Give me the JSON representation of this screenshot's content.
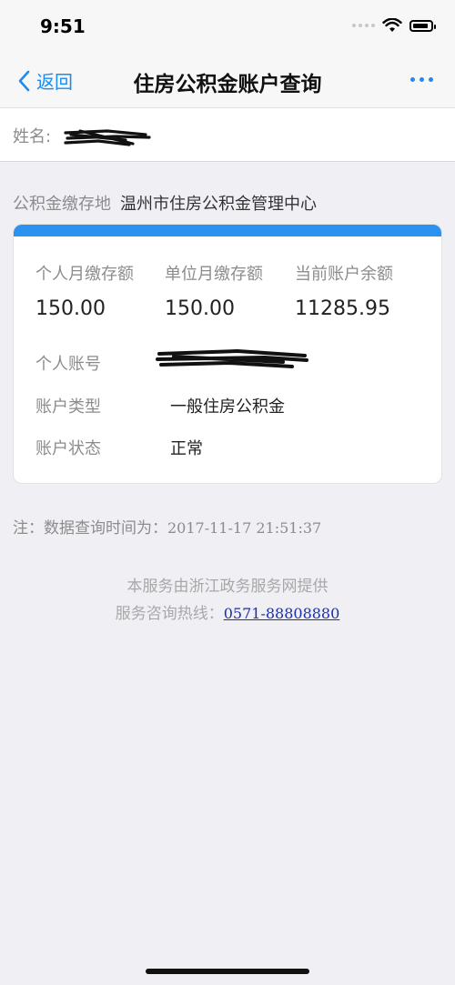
{
  "status_bar": {
    "time": "9:51"
  },
  "nav": {
    "back_label": "返回",
    "title": "住房公积金账户查询"
  },
  "name_row": {
    "label": "姓名:"
  },
  "fund_location": {
    "label": "公积金缴存地",
    "value": "温州市住房公积金管理中心"
  },
  "card": {
    "stats": [
      {
        "label": "个人月缴存额",
        "value": "150.00"
      },
      {
        "label": "单位月缴存额",
        "value": "150.00"
      },
      {
        "label": "当前账户余额",
        "value": "11285.95"
      }
    ],
    "info": [
      {
        "label": "个人账号",
        "value": ""
      },
      {
        "label": "账户类型",
        "value": "一般住房公积金"
      },
      {
        "label": "账户状态",
        "value": "正常"
      }
    ]
  },
  "note": {
    "prefix": "注：数据查询时间为：",
    "time": "2017-11-17 21:51:37"
  },
  "footer": {
    "provider": "本服务由浙江政务服务网提供",
    "hotline_label": "服务咨询热线：",
    "hotline_number": "0571-88808880"
  },
  "colors": {
    "accent": "#1b8cf0",
    "card_header": "#2b92ef",
    "link": "#1a2fb0"
  }
}
